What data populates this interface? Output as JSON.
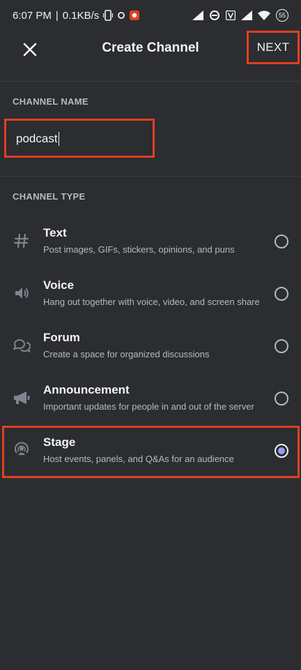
{
  "statusbar": {
    "time": "6:07 PM",
    "speed": "0.1KB/s",
    "battery": "55"
  },
  "header": {
    "title": "Create Channel",
    "next_label": "NEXT"
  },
  "channel_name": {
    "label": "CHANNEL NAME",
    "value": "podcast"
  },
  "channel_type": {
    "label": "CHANNEL TYPE",
    "options": [
      {
        "name": "Text",
        "description": "Post images, GIFs, stickers, opinions, and puns",
        "icon": "hash-icon",
        "selected": false
      },
      {
        "name": "Voice",
        "description": "Hang out together with voice, video, and screen share",
        "icon": "speaker-icon",
        "selected": false
      },
      {
        "name": "Forum",
        "description": "Create a space for organized discussions",
        "icon": "forum-icon",
        "selected": false
      },
      {
        "name": "Announcement",
        "description": "Important updates for people in and out of the server",
        "icon": "megaphone-icon",
        "selected": false
      },
      {
        "name": "Stage",
        "description": "Host events, panels, and Q&As for an audience",
        "icon": "stage-icon",
        "selected": true
      }
    ]
  },
  "colors": {
    "background": "#2b2d31",
    "highlight": "#e0401f",
    "accent": "#949cf7"
  }
}
